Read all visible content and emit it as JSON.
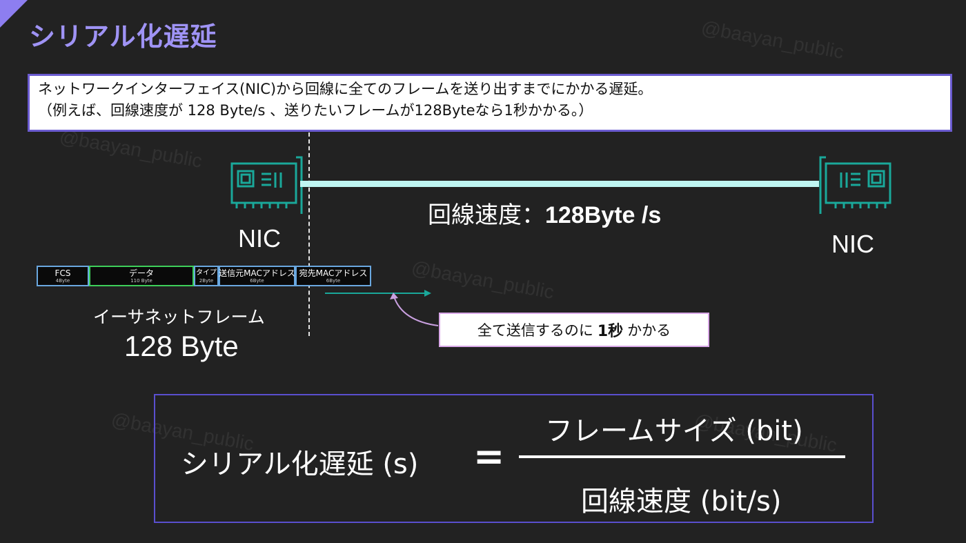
{
  "slide": {
    "title": "シリアル化遅延",
    "watermark": "@baayan_public",
    "description": [
      "ネットワークインターフェイス(NIC)から回線に全てのフレームを送り出すまでにかかる遅延。",
      "（例えば、回線速度が 128 Byte/s 、送りたいフレームが128Byteなら1秒かかる。）"
    ]
  },
  "diagram": {
    "nic_left_label": "NIC",
    "nic_right_label": "NIC",
    "speed_prefix": "回線速度：",
    "speed_value": "128Byte /s",
    "frame": {
      "fields": [
        {
          "name": "FCS",
          "size": "4Byte",
          "color": "blue"
        },
        {
          "name": "データ",
          "size": "110 Byte",
          "color": "green"
        },
        {
          "name": "タイプ",
          "size": "2Byte",
          "color": "blue"
        },
        {
          "name": "送信元MACアドレス",
          "size": "6Byte",
          "color": "blue"
        },
        {
          "name": "宛先MACアドレス",
          "size": "6Byte",
          "color": "blue"
        }
      ],
      "label": "イーサネットフレーム",
      "size_label": "128 Byte"
    },
    "callout": {
      "prefix": "全て送信するのに",
      "emphasis": "1秒",
      "suffix": "かかる"
    }
  },
  "formula": {
    "lhs": "シリアル化遅延 (s)",
    "equals": "=",
    "numerator": "フレームサイズ (bit)",
    "denominator": "回線速度 (bit/s)"
  },
  "colors": {
    "title": "#9f93f5",
    "accent": "#6b5bd0",
    "nic": "#1aa89a",
    "link": "#bff6f2",
    "arrow": "#1aa89a",
    "callout_pointer": "#c9a0e0"
  }
}
